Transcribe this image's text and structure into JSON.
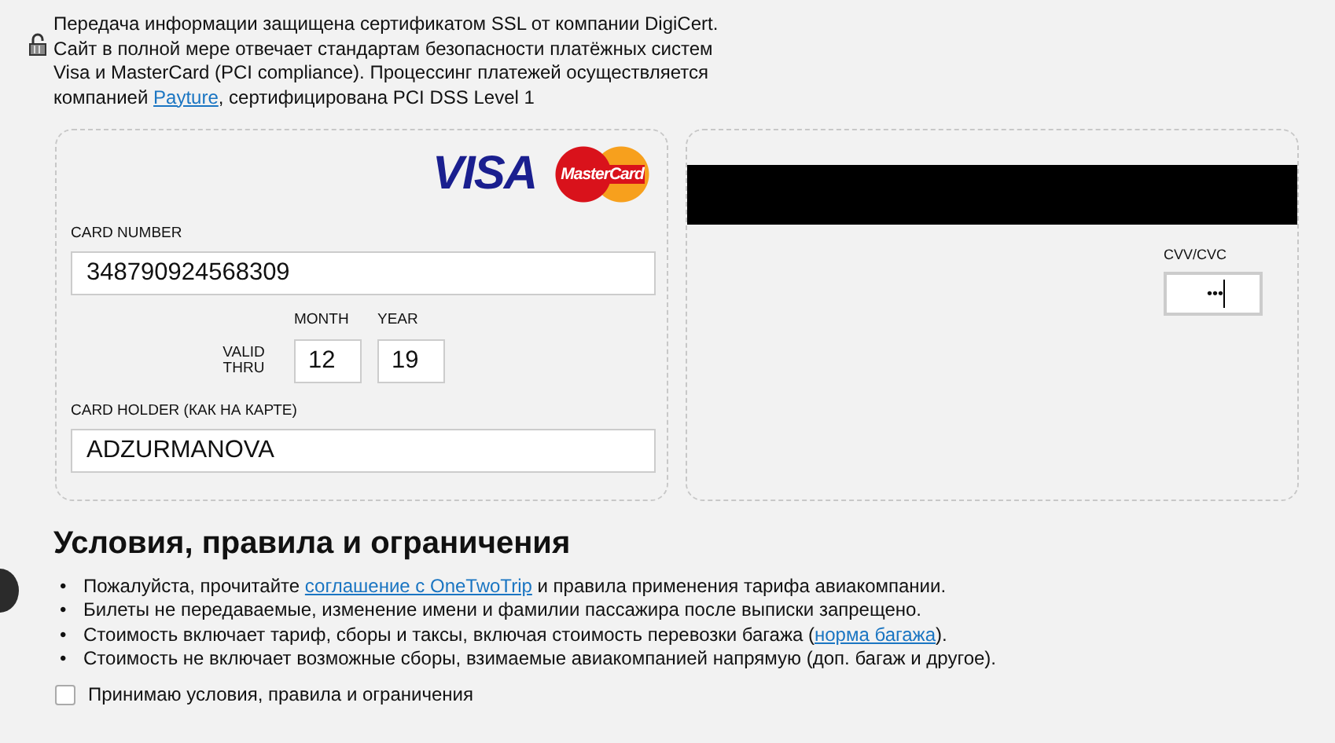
{
  "security_notice": {
    "lines": [
      "Передача информации защищена сертификатом SSL от компании DigiCert.",
      "Сайт в полной мере отвечает стандартам безопасности платёжных систем",
      "Visa и MasterCard (PCI compliance). Процессинг платежей осуществляется"
    ],
    "last_line": {
      "before": "компанией ",
      "link": "Payture",
      "after": ", сертифицирована PCI DSS Level 1"
    }
  },
  "card_front": {
    "logos": [
      {
        "kind": "visa",
        "text": "VISA"
      },
      {
        "kind": "mastercard",
        "text": "MasterCard"
      }
    ],
    "card_number": {
      "label": "CARD NUMBER",
      "value": "348790924568309"
    },
    "valid_thru": {
      "label": "VALID THRU",
      "month_label": "MONTH",
      "month": "12",
      "year_label": "YEAR",
      "year": "19"
    },
    "card_holder": {
      "label": "CARD HOLDER (КАК НА КАРТЕ)",
      "value": "ADZURMANOVA"
    }
  },
  "card_back": {
    "cvv_label": "CVV/CVC",
    "cvv_value": "•••"
  },
  "terms": {
    "title": "Условия, правила и ограничения",
    "items": [
      {
        "bullet": "•",
        "before": "Пожалуйста, прочитайте ",
        "link": "соглашение с OneTwoTrip",
        "after": " и правила применения тарифа авиакомпании."
      },
      {
        "bullet": "•",
        "before": "Билеты не передаваемые, изменение имени и фамилии пассажира после выписки запрещено."
      },
      {
        "bullet": "•",
        "before": "Стоимость включает тариф, сборы и таксы, включая стоимость перевозки багажа (",
        "link": "норма багажа",
        "after": ")."
      },
      {
        "bullet": "•",
        "before": "Стоимость не включает возможные сборы, взимаемые авиакомпанией напрямую (доп. багаж и другое)."
      }
    ],
    "accept": {
      "label": "Принимаю условия, правила и ограничения",
      "checked": false
    }
  }
}
